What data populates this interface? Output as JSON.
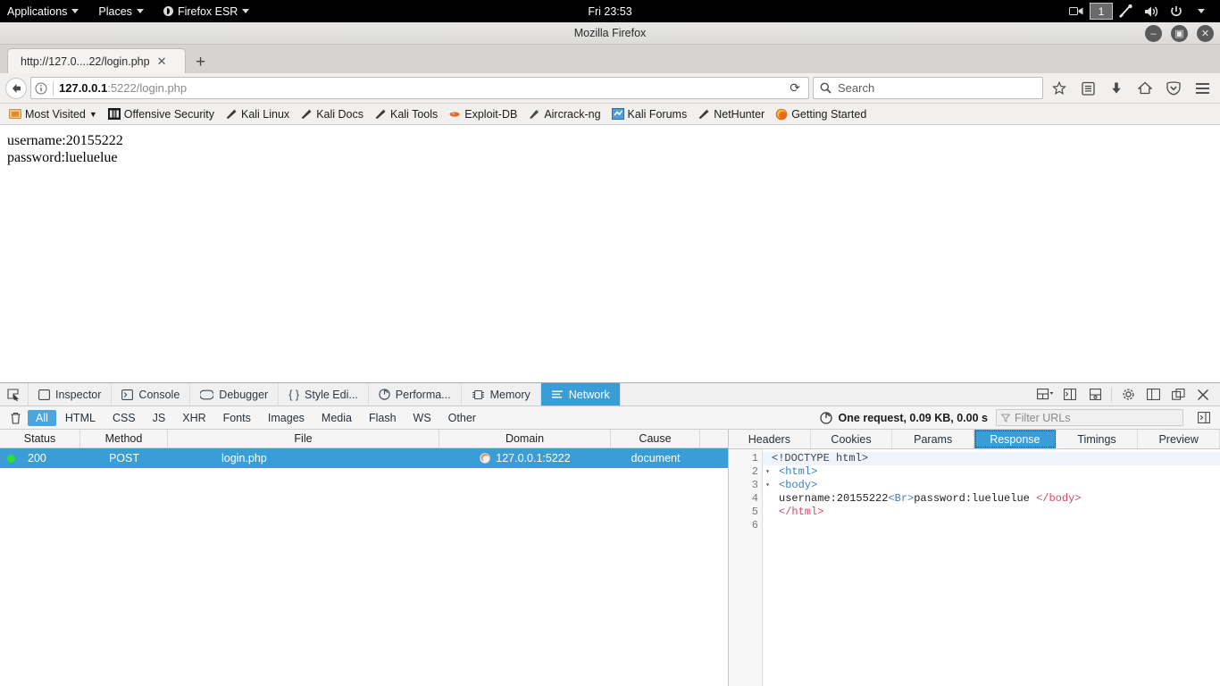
{
  "desktop": {
    "applications_label": "Applications",
    "places_label": "Places",
    "firefox_label": "Firefox ESR",
    "clock": "Fri 23:53",
    "workspace_badge": "1"
  },
  "window": {
    "title": "Mozilla Firefox",
    "minimize": "–",
    "maximize": "▣",
    "close": "✕"
  },
  "tabs": {
    "items": [
      {
        "title": "http://127.0....22/login.php",
        "close": "✕"
      }
    ],
    "new_tab": "+"
  },
  "navbar": {
    "back": "←",
    "url_host": "127.0.0.1",
    "url_rest": ":5222/login.php",
    "reload": "⟳",
    "search_placeholder": "Search",
    "icons": [
      "star-icon",
      "library-icon",
      "downloads-icon",
      "home-icon",
      "pocket-icon",
      "menu-icon"
    ]
  },
  "bookmarks": [
    {
      "label": "Most Visited",
      "icon": "folder-icon",
      "caret": true
    },
    {
      "label": "Offensive Security",
      "icon": "offsec-icon",
      "caret": false
    },
    {
      "label": "Kali Linux",
      "icon": "dragon-icon",
      "caret": false
    },
    {
      "label": "Kali Docs",
      "icon": "dragon-icon",
      "caret": false
    },
    {
      "label": "Kali Tools",
      "icon": "dragon-icon",
      "caret": false
    },
    {
      "label": "Exploit-DB",
      "icon": "exploitdb-icon",
      "caret": false
    },
    {
      "label": "Aircrack-ng",
      "icon": "aircrack-icon",
      "caret": false
    },
    {
      "label": "Kali Forums",
      "icon": "forums-icon",
      "caret": false
    },
    {
      "label": "NetHunter",
      "icon": "dragon-icon",
      "caret": false
    },
    {
      "label": "Getting Started",
      "icon": "firefox-icon",
      "caret": false
    }
  ],
  "page_content": {
    "line1": "username:20155222",
    "line2": "password:lueluelue"
  },
  "devtools": {
    "tabs": [
      {
        "label": "Inspector",
        "icon": "inspector-icon",
        "active": false
      },
      {
        "label": "Console",
        "icon": "console-icon",
        "active": false
      },
      {
        "label": "Debugger",
        "icon": "debugger-icon",
        "active": false
      },
      {
        "label": "Style Edi...",
        "icon": "style-editor-icon",
        "active": false
      },
      {
        "label": "Performa...",
        "icon": "performance-icon",
        "active": false
      },
      {
        "label": "Memory",
        "icon": "memory-icon",
        "active": false
      },
      {
        "label": "Network",
        "icon": "network-icon",
        "active": true
      }
    ],
    "filters": [
      {
        "label": "All",
        "active": true
      },
      {
        "label": "HTML",
        "active": false
      },
      {
        "label": "CSS",
        "active": false
      },
      {
        "label": "JS",
        "active": false
      },
      {
        "label": "XHR",
        "active": false
      },
      {
        "label": "Fonts",
        "active": false
      },
      {
        "label": "Images",
        "active": false
      },
      {
        "label": "Media",
        "active": false
      },
      {
        "label": "Flash",
        "active": false
      },
      {
        "label": "WS",
        "active": false
      },
      {
        "label": "Other",
        "active": false
      }
    ],
    "summary": "One request, 0.09 KB, 0.00 s",
    "filter_placeholder": "Filter URLs",
    "columns": [
      "Status",
      "Method",
      "File",
      "Domain",
      "Cause"
    ],
    "rows": [
      {
        "status": "200",
        "method": "POST",
        "file": "login.php",
        "domain": "127.0.0.1:5222",
        "cause": "document"
      }
    ],
    "detail_tabs": [
      {
        "label": "Headers",
        "active": false
      },
      {
        "label": "Cookies",
        "active": false
      },
      {
        "label": "Params",
        "active": false
      },
      {
        "label": "Response",
        "active": true
      },
      {
        "label": "Timings",
        "active": false
      },
      {
        "label": "Preview",
        "active": false
      }
    ],
    "response_lines": [
      {
        "num": "1",
        "fold": "",
        "html": "<span class=\"doctype\">&lt;!DOCTYPE html&gt;</span>"
      },
      {
        "num": "2",
        "fold": "▾",
        "html": "<span class=\"ind\"></span><span class=\"tag\">&lt;html&gt;</span>"
      },
      {
        "num": "3",
        "fold": "▾",
        "html": "<span class=\"ind\"></span><span class=\"tag\">&lt;body&gt;</span>"
      },
      {
        "num": "4",
        "fold": "",
        "html": "<span class=\"ind\"></span>username:20155222<span class=\"tag\">&lt;Br&gt;</span>password:lueluelue <span class=\"ctag\">&lt;/body&gt;</span>"
      },
      {
        "num": "5",
        "fold": "",
        "html": "<span class=\"ind\"></span><span class=\"ctag\">&lt;/html&gt;</span>"
      },
      {
        "num": "6",
        "fold": "",
        "html": ""
      }
    ]
  },
  "colors": {
    "accent": "#3b9dd6",
    "filter_active": "#4ba6e0",
    "status_ok": "#30e030",
    "tag": "#3a7fc1",
    "closing_tag": "#d24a6a"
  }
}
